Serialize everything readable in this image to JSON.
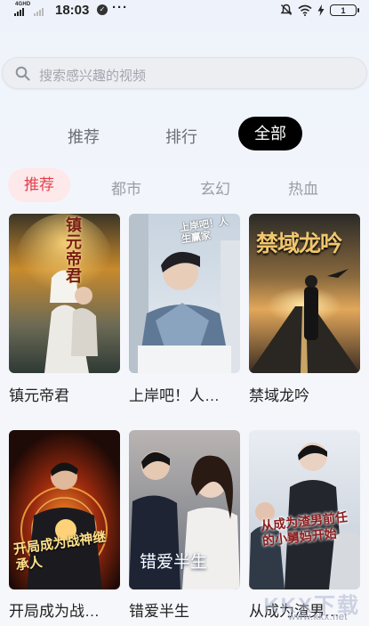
{
  "status_bar": {
    "network": "4GHD",
    "time": "18:03",
    "more": "···",
    "battery": "1"
  },
  "search": {
    "placeholder": "搜索感兴趣的视频"
  },
  "tabs": [
    {
      "label": "推荐",
      "active": false
    },
    {
      "label": "排行",
      "active": false
    },
    {
      "label": "全部",
      "active": true
    }
  ],
  "categories": [
    {
      "label": "推荐",
      "active": true
    },
    {
      "label": "都市",
      "active": false
    },
    {
      "label": "玄幻",
      "active": false
    },
    {
      "label": "热血",
      "active": false
    }
  ],
  "dramas": [
    {
      "title": "镇元帝君",
      "poster_text": "镇元帝君"
    },
    {
      "title": "上岸吧！人…",
      "poster_text": "上岸吧！人生赢家"
    },
    {
      "title": "禁域龙吟",
      "poster_text": "禁域龙吟"
    },
    {
      "title": "开局成为战…",
      "poster_text": "开局成为战神继承人"
    },
    {
      "title": "错爱半生",
      "poster_text": "错爱半生"
    },
    {
      "title": "从成为渣男…",
      "poster_text": "从成为渣男前任的小舅妈开始"
    }
  ],
  "watermark": {
    "main": "KKX下载",
    "sub": "www.kkx.net"
  },
  "colors": {
    "accent_red": "#e2414d",
    "active_tab_bg": "#000000",
    "category_active_bg": "#fde8ea"
  }
}
